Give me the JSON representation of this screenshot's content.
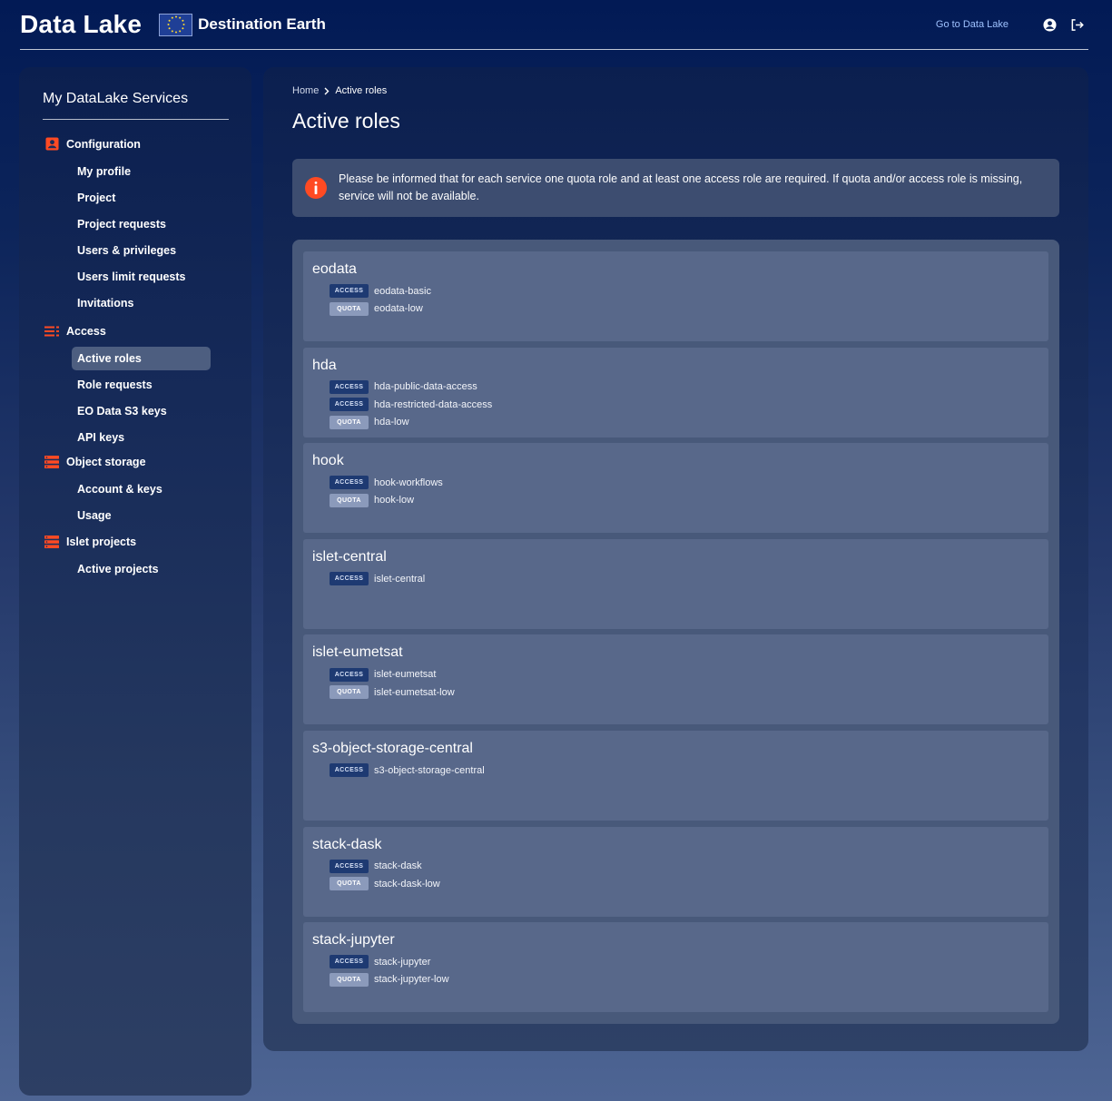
{
  "header": {
    "title": "Data Lake",
    "logo_text": "Destination Earth",
    "go_link": "Go to Data Lake",
    "icons": [
      "user-circle-icon",
      "logout-icon"
    ]
  },
  "sidebar": {
    "title": "My DataLake Services",
    "sections": [
      {
        "label": "Configuration",
        "icon": "account-box-icon",
        "items": [
          "My profile",
          "Project",
          "Project requests",
          "Users & privileges",
          "Users limit requests",
          "Invitations"
        ]
      },
      {
        "label": "Access",
        "icon": "list-icon",
        "items": [
          "Active roles",
          "Role requests",
          "EO Data S3 keys",
          "API keys"
        ]
      },
      {
        "label": "Object storage",
        "icon": "storage-icon",
        "items": [
          "Account & keys",
          "Usage"
        ]
      },
      {
        "label": "Islet projects",
        "icon": "storage-icon",
        "items": [
          "Active projects"
        ]
      }
    ],
    "active_item": "Active roles"
  },
  "main": {
    "breadcrumb": {
      "home": "Home",
      "current": "Active roles"
    },
    "title": "Active roles",
    "info": "Please be informed that for each service one quota role and at least one access role are required. If quota and/or access role is missing, service will not be available.",
    "services": [
      {
        "name": "eodata",
        "roles": [
          {
            "type": "ACCESS",
            "name": "eodata-basic"
          },
          {
            "type": "QUOTA",
            "name": "eodata-low"
          }
        ]
      },
      {
        "name": "hda",
        "roles": [
          {
            "type": "ACCESS",
            "name": "hda-public-data-access"
          },
          {
            "type": "ACCESS",
            "name": "hda-restricted-data-access"
          },
          {
            "type": "QUOTA",
            "name": "hda-low"
          }
        ]
      },
      {
        "name": "hook",
        "roles": [
          {
            "type": "ACCESS",
            "name": "hook-workflows"
          },
          {
            "type": "QUOTA",
            "name": "hook-low"
          }
        ]
      },
      {
        "name": "islet-central",
        "roles": [
          {
            "type": "ACCESS",
            "name": "islet-central"
          }
        ]
      },
      {
        "name": "islet-eumetsat",
        "roles": [
          {
            "type": "ACCESS",
            "name": "islet-eumetsat"
          },
          {
            "type": "QUOTA",
            "name": "islet-eumetsat-low"
          }
        ]
      },
      {
        "name": "s3-object-storage-central",
        "roles": [
          {
            "type": "ACCESS",
            "name": "s3-object-storage-central"
          }
        ]
      },
      {
        "name": "stack-dask",
        "roles": [
          {
            "type": "ACCESS",
            "name": "stack-dask"
          },
          {
            "type": "QUOTA",
            "name": "stack-dask-low"
          }
        ]
      },
      {
        "name": "stack-jupyter",
        "roles": [
          {
            "type": "ACCESS",
            "name": "stack-jupyter"
          },
          {
            "type": "QUOTA",
            "name": "stack-jupyter-low"
          }
        ]
      }
    ]
  },
  "colors": {
    "accent": "#ff4a23",
    "link": "#9ec2ff",
    "access_badge": "#1e3a72",
    "quota_badge": "#8b9abb"
  }
}
